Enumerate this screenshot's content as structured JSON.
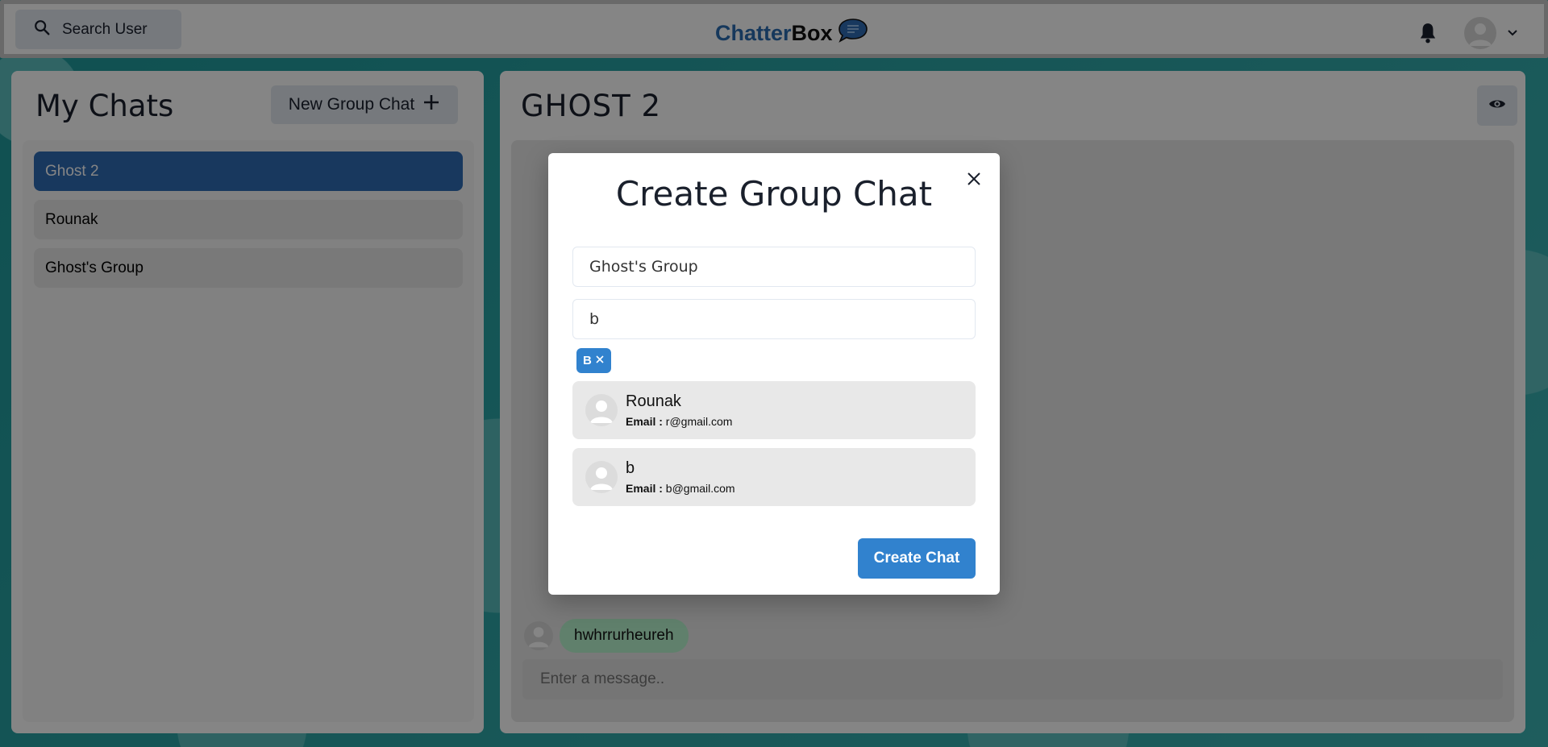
{
  "header": {
    "search_label": "Search User",
    "brand_part1": "Chatter",
    "brand_part2": "Box",
    "icons": [
      "search-icon",
      "chat-bubble-logo-icon",
      "bell-icon",
      "avatar-icon",
      "chevron-down-icon"
    ]
  },
  "sidebar": {
    "title": "My Chats",
    "new_group_label": "New Group Chat",
    "chats": [
      {
        "label": "Ghost 2",
        "active": true
      },
      {
        "label": "Rounak",
        "active": false
      },
      {
        "label": "Ghost's Group",
        "active": false
      }
    ]
  },
  "chat": {
    "title": "GHOST 2",
    "messages": [
      {
        "text": "hwhrrurheureh"
      }
    ],
    "input_placeholder": "Enter a message.."
  },
  "modal": {
    "title": "Create Group Chat",
    "group_name_value": "Ghost's Group",
    "search_value": "b",
    "selected_users": [
      {
        "label": "B"
      }
    ],
    "results": [
      {
        "name": "Rounak",
        "email_label": "Email :",
        "email": "r@gmail.com"
      },
      {
        "name": "b",
        "email_label": "Email :",
        "email": "b@gmail.com"
      }
    ],
    "create_label": "Create Chat"
  },
  "colors": {
    "active_chat": "#2f6bb5",
    "primary_button": "#3182ce",
    "message_bubble": "#b9f5d0",
    "brand_blue": "#2b6cb0"
  }
}
